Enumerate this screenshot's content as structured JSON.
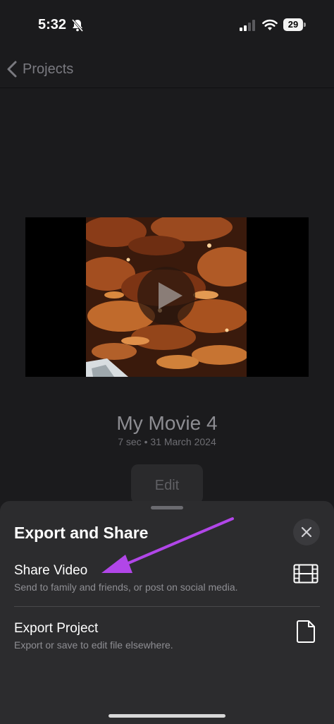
{
  "status_bar": {
    "time": "5:32",
    "battery": "29"
  },
  "nav": {
    "back_label": "Projects"
  },
  "movie": {
    "title": "My Movie 4",
    "meta": "7 sec • 31 March 2024",
    "edit_label": "Edit"
  },
  "sheet": {
    "title": "Export and Share",
    "options": [
      {
        "title": "Share Video",
        "subtitle": "Send to family and friends, or post on social media.",
        "icon": "film-icon"
      },
      {
        "title": "Export Project",
        "subtitle": "Export or save to edit file elsewhere.",
        "icon": "document-icon"
      }
    ]
  },
  "colors": {
    "background": "#1b1b1d",
    "sheet": "#2c2c2e",
    "annotation_arrow": "#b146e8"
  }
}
